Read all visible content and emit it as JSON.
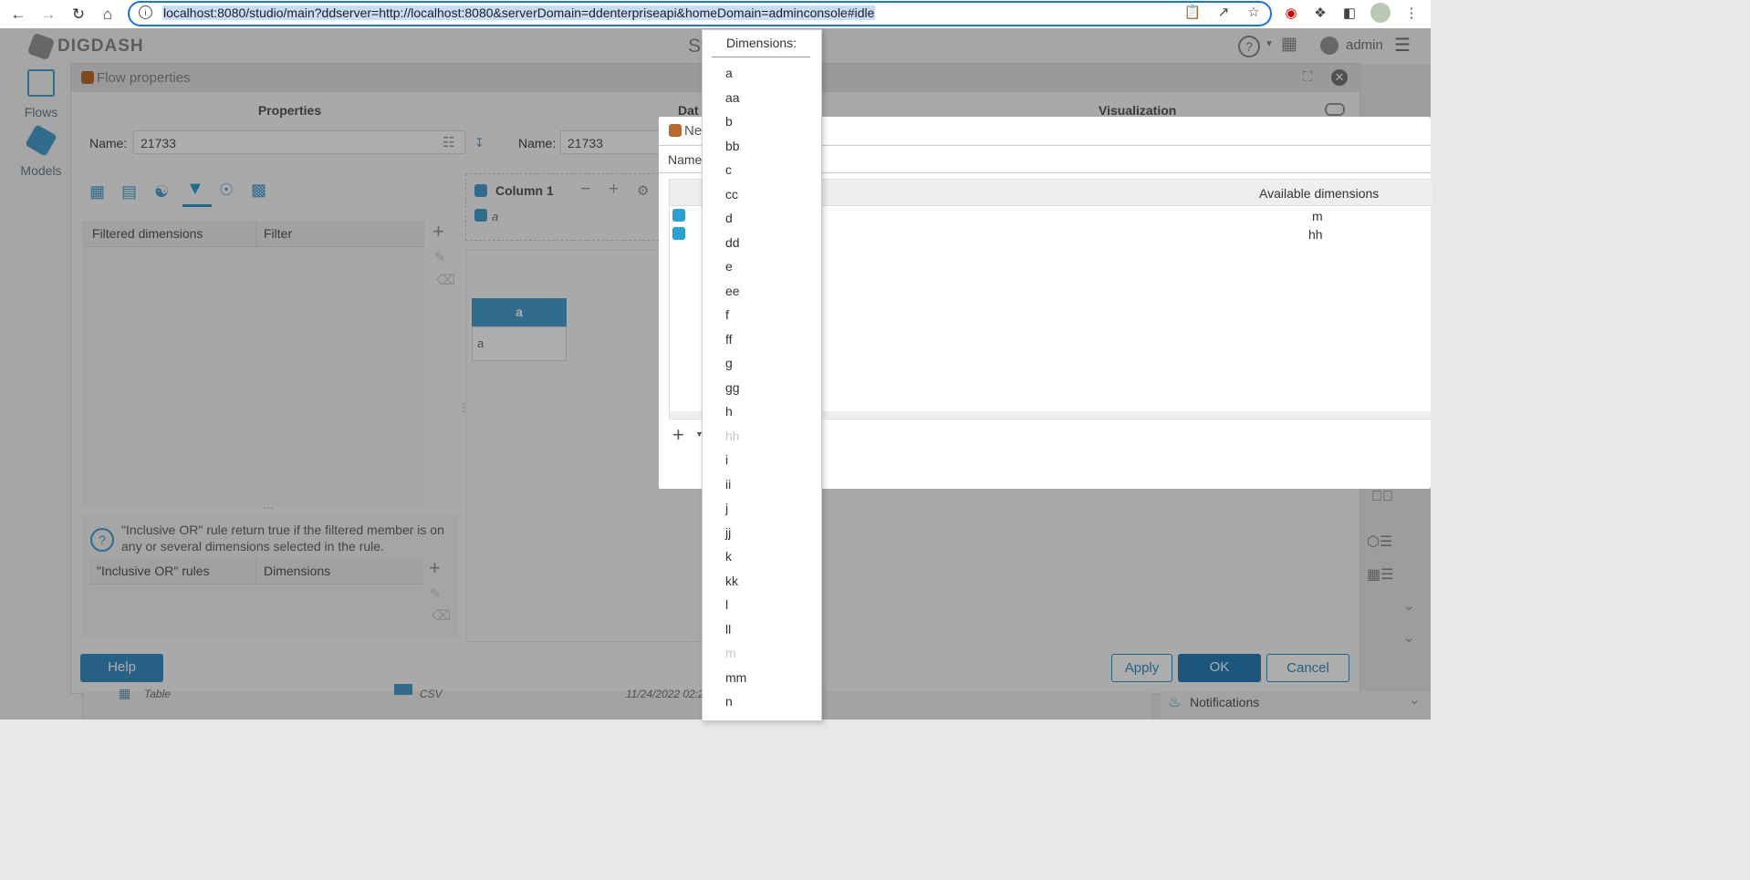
{
  "browser": {
    "url": "localhost:8080/studio/main?ddserver=http://localhost:8080&serverDomain=ddenterpriseapi&homeDomain=adminconsole#idle"
  },
  "app": {
    "logo": "DIGDASH",
    "header_title_partial": "St",
    "user": "admin",
    "nav": [
      {
        "label": "Flows"
      },
      {
        "label": "Models"
      }
    ]
  },
  "flow_dialog": {
    "title": "Flow properties",
    "properties": {
      "title": "Properties",
      "name_label": "Name:",
      "name_value": "21733"
    },
    "data": {
      "title_partial": "Dat",
      "name_label": "Name:",
      "name_value": "21733"
    },
    "visualization": {
      "title": "Visualization"
    },
    "filter_table": {
      "col1": "Filtered dimensions",
      "col2": "Filter"
    },
    "info_text": "\"Inclusive OR\" rule return true if the filtered member is on any or several dimensions selected in the rule.",
    "or_table": {
      "col1": "\"Inclusive OR\" rules",
      "col2": "Dimensions"
    },
    "column": {
      "label": "Column 1",
      "item": "a"
    },
    "mini_table": {
      "header": "a",
      "cell": "a"
    },
    "buttons": {
      "help": "Help",
      "apply": "Apply",
      "ok": "OK",
      "cancel": "Cancel"
    }
  },
  "background_row": {
    "type": "Table",
    "source": "CSV",
    "date": "11/24/2022 02:2"
  },
  "notifications": "Notifications",
  "new_dialog": {
    "title_partial": "Ne",
    "name_label": "Name",
    "available_header": "Available dimensions",
    "rows": [
      {
        "available": "m"
      },
      {
        "available": "hh"
      }
    ]
  },
  "dropdown": {
    "header": "Dimensions:",
    "items": [
      {
        "label": "a",
        "disabled": false
      },
      {
        "label": "aa",
        "disabled": false
      },
      {
        "label": "b",
        "disabled": false
      },
      {
        "label": "bb",
        "disabled": false
      },
      {
        "label": "c",
        "disabled": false
      },
      {
        "label": "cc",
        "disabled": false
      },
      {
        "label": "d",
        "disabled": false
      },
      {
        "label": "dd",
        "disabled": false
      },
      {
        "label": "e",
        "disabled": false
      },
      {
        "label": "ee",
        "disabled": false
      },
      {
        "label": "f",
        "disabled": false
      },
      {
        "label": "ff",
        "disabled": false
      },
      {
        "label": "g",
        "disabled": false
      },
      {
        "label": "gg",
        "disabled": false
      },
      {
        "label": "h",
        "disabled": false
      },
      {
        "label": "hh",
        "disabled": true
      },
      {
        "label": "i",
        "disabled": false
      },
      {
        "label": "ii",
        "disabled": false
      },
      {
        "label": "j",
        "disabled": false
      },
      {
        "label": "jj",
        "disabled": false
      },
      {
        "label": "k",
        "disabled": false
      },
      {
        "label": "kk",
        "disabled": false
      },
      {
        "label": "l",
        "disabled": false
      },
      {
        "label": "ll",
        "disabled": false
      },
      {
        "label": "m",
        "disabled": true
      },
      {
        "label": "mm",
        "disabled": false
      },
      {
        "label": "n",
        "disabled": false
      }
    ]
  },
  "colors": {
    "accent": "#2a9fd6",
    "url_focus": "#1a73e8",
    "disabled_text": "#c8c8c8",
    "button_blue": "#2a7fb8"
  }
}
